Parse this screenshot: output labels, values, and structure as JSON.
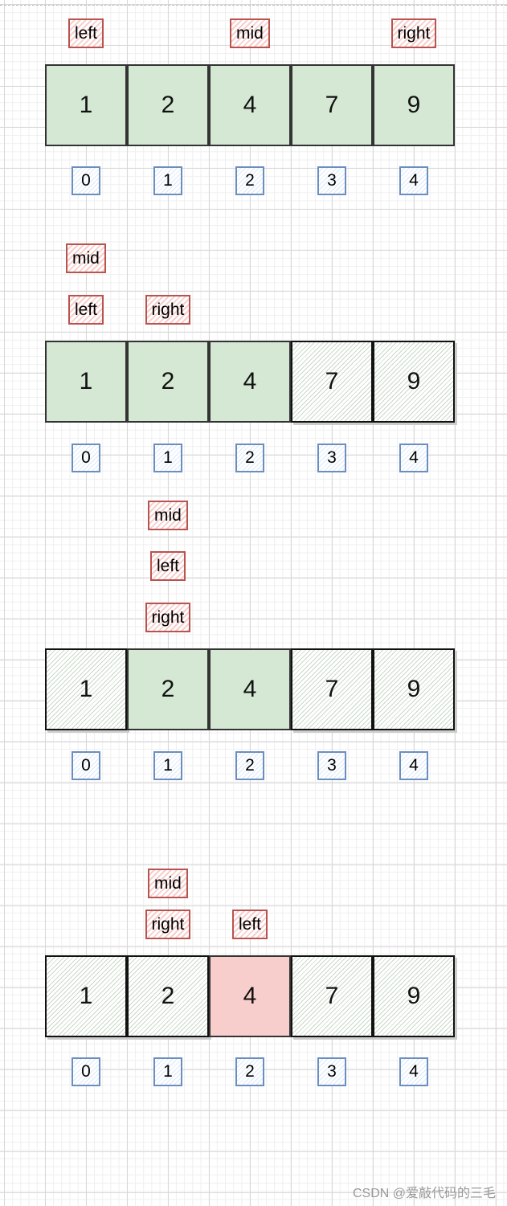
{
  "colors": {
    "active": "#d5e8d4",
    "eliminated": "hatched",
    "found": "#f8cecc",
    "pointer_border": "#b85450",
    "index_border": "#6c8ebf"
  },
  "array": [
    "1",
    "2",
    "4",
    "7",
    "9"
  ],
  "indices": [
    "0",
    "1",
    "2",
    "3",
    "4"
  ],
  "steps": [
    {
      "states": [
        "active",
        "active",
        "active",
        "active",
        "active"
      ],
      "pointers": [
        {
          "label": "left",
          "col": 0,
          "row": 0
        },
        {
          "label": "mid",
          "col": 2,
          "row": 0
        },
        {
          "label": "right",
          "col": 4,
          "row": 0
        }
      ]
    },
    {
      "states": [
        "active",
        "active",
        "active",
        "hatched",
        "hatched"
      ],
      "pointers": [
        {
          "label": "mid",
          "col": 0,
          "row": 0
        },
        {
          "label": "left",
          "col": 0,
          "row": 1
        },
        {
          "label": "right",
          "col": 1,
          "row": 1
        }
      ]
    },
    {
      "states": [
        "hatched",
        "active",
        "active",
        "hatched",
        "hatched"
      ],
      "pointers": [
        {
          "label": "mid",
          "col": 1,
          "row": 0
        },
        {
          "label": "left",
          "col": 1,
          "row": 1
        },
        {
          "label": "right",
          "col": 1,
          "row": 2
        }
      ]
    },
    {
      "states": [
        "hatched",
        "hatched",
        "hit",
        "hatched",
        "hatched"
      ],
      "pointers": [
        {
          "label": "mid",
          "col": 1,
          "row": 0
        },
        {
          "label": "right",
          "col": 1,
          "row": 1
        },
        {
          "label": "left",
          "col": 2,
          "row": 1
        }
      ]
    }
  ],
  "watermark": "CSDN @爱敲代码的三毛"
}
